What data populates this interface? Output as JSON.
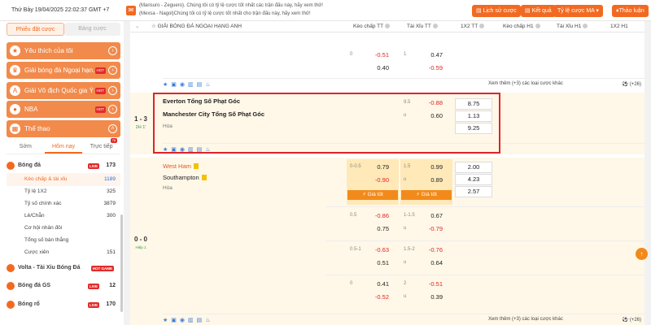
{
  "topbar": {
    "datetime": "Thứ Bảy 19/04/2025 22:02:37 GMT +7",
    "ticker_lines": [
      "(Mansuro - Zeguero). Chúng tôi có tỷ lệ cược tốt nhất các trận đấu này, hãy xem thử!",
      "(Mexsa - Nagol)Chúng tôi có tỷ lệ cược tốt nhất cho trận đấu này, hãy xem thử!"
    ],
    "buttons": [
      "Lịch sử cược",
      "Kết quả",
      "Tỷ lệ cược MA",
      "Thảo luận"
    ]
  },
  "sidebar": {
    "tabs": [
      "Phiếu đặt cược",
      "Bảng cược"
    ],
    "menu": [
      {
        "label": "Yêu thích của tôi",
        "hot": ""
      },
      {
        "label": "Giải bóng đá Ngoại hạn...",
        "hot": "HOT"
      },
      {
        "label": "Giải Vô địch Quốc gia Ý ...",
        "hot": "HOT"
      },
      {
        "label": "NBA",
        "hot": "HOT"
      },
      {
        "label": "Thể thao",
        "hot": ""
      }
    ],
    "subtabs": [
      "Sớm",
      "Hôm nay",
      "Trực tiếp"
    ],
    "subtab_badge": "78",
    "football": {
      "label": "Bóng đá",
      "live": "LIVE",
      "count": "173"
    },
    "football_items": [
      {
        "label": "Kèo chấp & tài xỉu",
        "count": "1189"
      },
      {
        "label": "Tỷ lệ 1X2",
        "count": "325"
      },
      {
        "label": "Tỷ số chính xác",
        "count": "3879"
      },
      {
        "label": "Lẻ/Chẵn",
        "count": "300"
      },
      {
        "label": "Cơ hội nhân đôi",
        "count": ""
      },
      {
        "label": "Tổng số bàn thắng",
        "count": ""
      },
      {
        "label": "Cược xiên",
        "count": "151"
      }
    ],
    "others": [
      {
        "label": "Volta - Tài Xỉu Bóng Đá",
        "live": "HOT GAME",
        "count": ""
      },
      {
        "label": "Bóng đá GS",
        "live": "LIVE",
        "count": "12"
      },
      {
        "label": "Bóng rổ",
        "live": "LIVE",
        "count": "170"
      }
    ]
  },
  "header": {
    "league": "GIẢI BÓNG ĐÁ NGOẠI HẠNG ANH",
    "cols": [
      "Kèo chấp TT",
      "Tài Xỉu TT",
      "1X2 TT",
      "Kèo chấp H1",
      "Tài Xỉu H1",
      "1X2 H1"
    ]
  },
  "top_block": {
    "hc1": "0",
    "hc1_val": "-0.51",
    "hc1_b": "0.40",
    "ou1": "1",
    "ou1_val": "0.47",
    "ou1_b": "-0.59",
    "more": "Xem thêm (+3) các loại cược khác",
    "plus": "(+26)"
  },
  "match1": {
    "score": "1 - 3",
    "time": "2H 1'",
    "home": "Everton Tổng Số Phạt Góc",
    "away": "Manchester City Tổng Số Phạt Góc",
    "draw": "Hòa",
    "ou_line": "9.5",
    "ou_val1": "-0.88",
    "ou_u": "u",
    "ou_val2": "0.60",
    "x12": [
      "8.75",
      "1.13",
      "9.25"
    ]
  },
  "match2": {
    "score": "0 - 0",
    "part": "Hiệp 1",
    "home": "West Ham",
    "away": "Southampton",
    "draw": "Hòa",
    "row1": {
      "hc": "0-0.5",
      "hcv1": "0.79",
      "hcv2": "-0.90",
      "ou": "1.5",
      "ouv1": "0.99",
      "ou_u": "u",
      "ouv2": "0.89"
    },
    "x12": [
      "2.00",
      "4.23",
      "2.57"
    ],
    "good": "Giá tốt",
    "alt": [
      {
        "hc": "0.5",
        "hcv1": "-0.86",
        "hcv2": "0.75",
        "ou": "1-1.5",
        "ouv1": "0.67",
        "ou_u": "u",
        "ouv2": "-0.79"
      },
      {
        "hc": "0.5-1",
        "hcv1": "-0.63",
        "hcv2": "0.51",
        "ou": "1.5-2",
        "ouv1": "-0.76",
        "ou_u": "u",
        "ouv2": "0.64"
      },
      {
        "hc": "0",
        "hcv1": "0.41",
        "hcv2": "-0.52",
        "ou": "2",
        "ouv1": "-0.51",
        "ou_u": "u",
        "ouv2": "0.39"
      }
    ],
    "more": "Xem thêm (+3) các loại cược khác",
    "plus": "(+26)"
  }
}
